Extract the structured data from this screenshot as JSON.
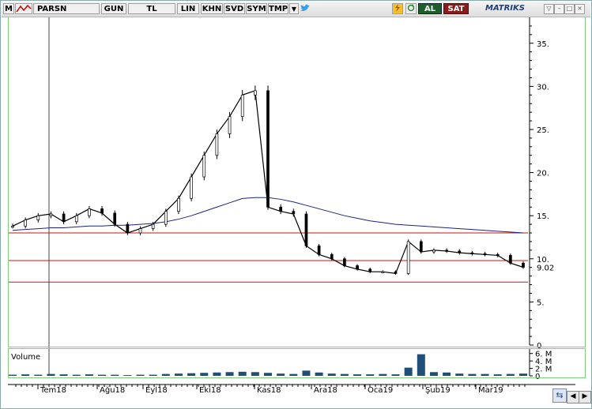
{
  "toolbar": {
    "menu_m": "M",
    "symbol": "PARSN",
    "period": "GUN",
    "currency": "TL",
    "scale": "LIN",
    "btn_khn": "KHN",
    "btn_svd": "SVD",
    "btn_sym": "SYM",
    "btn_tmp": "TMP",
    "buy": "AL",
    "sell": "SAT",
    "brand": "MATRIKS"
  },
  "y_axis": {
    "ticks": [
      "35.",
      "30.",
      "25.",
      "20.",
      "15.",
      "10.",
      "5.",
      "0"
    ],
    "last_price": "9.02"
  },
  "volume": {
    "title": "Volume",
    "ticks": [
      "6. M",
      "4. M",
      "2. M",
      "0"
    ]
  },
  "x_axis": {
    "labels": [
      "Tem18",
      "Ağu18",
      "Eyl18",
      "Eki18",
      "Kas18",
      "Ara18",
      "Oca19",
      "Şub19",
      "Mar19"
    ]
  },
  "colors": {
    "candle": "#000000",
    "moving_average": "#1a237e",
    "hline": "#d01010",
    "volume": "#1f4e79",
    "panel_border": "#7fcf7f"
  },
  "chart_data": {
    "type": "line",
    "title": "",
    "xlabel": "",
    "ylabel": "",
    "ylim": [
      0,
      38
    ],
    "x": [
      "2018-06-27",
      "2018-07-03",
      "2018-07-10",
      "2018-07-17",
      "2018-07-24",
      "2018-07-31",
      "2018-08-07",
      "2018-08-14",
      "2018-08-21",
      "2018-08-28",
      "2018-09-04",
      "2018-09-11",
      "2018-09-18",
      "2018-09-25",
      "2018-10-02",
      "2018-10-09",
      "2018-10-16",
      "2018-10-23",
      "2018-10-30",
      "2018-11-02",
      "2018-11-06",
      "2018-11-13",
      "2018-11-20",
      "2018-11-27",
      "2018-12-04",
      "2018-12-11",
      "2018-12-18",
      "2018-12-25",
      "2019-01-02",
      "2019-01-09",
      "2019-01-16",
      "2019-01-23",
      "2019-01-30",
      "2019-02-06",
      "2019-02-13",
      "2019-02-20",
      "2019-02-27",
      "2019-03-06",
      "2019-03-13",
      "2019-03-20",
      "2019-03-27"
    ],
    "series": [
      {
        "values": [
          13.8,
          14.5,
          15.0,
          15.2,
          14.3,
          15.0,
          15.8,
          15.3,
          14.0,
          13.0,
          13.5,
          14.0,
          15.5,
          17.0,
          19.5,
          22.0,
          24.5,
          26.5,
          29.0,
          29.5,
          16.0,
          15.5,
          15.2,
          11.5,
          10.5,
          10.0,
          9.2,
          8.8,
          8.5,
          8.5,
          8.3,
          12.0,
          10.8,
          11.0,
          10.9,
          10.7,
          10.6,
          10.5,
          10.4,
          9.5,
          9.02
        ]
      },
      {
        "values": [
          13.3,
          13.4,
          13.5,
          13.6,
          13.6,
          13.7,
          13.8,
          13.8,
          13.9,
          13.9,
          14.0,
          14.1,
          14.3,
          14.6,
          15.0,
          15.5,
          16.0,
          16.5,
          17.0,
          17.1,
          17.1,
          16.9,
          16.6,
          16.2,
          15.8,
          15.4,
          15.0,
          14.7,
          14.4,
          14.2,
          14.0,
          13.9,
          13.8,
          13.7,
          13.6,
          13.5,
          13.4,
          13.3,
          13.2,
          13.1,
          13.0
        ]
      }
    ],
    "hlines": [
      13.0,
      9.8,
      7.3
    ],
    "volume_millions": [
      0.3,
      0.4,
      0.3,
      0.5,
      0.4,
      0.3,
      0.4,
      0.3,
      0.3,
      0.2,
      0.3,
      0.3,
      0.5,
      0.6,
      0.7,
      0.8,
      0.9,
      1.0,
      1.1,
      1.0,
      0.8,
      0.6,
      0.5,
      1.4,
      0.9,
      0.6,
      0.5,
      0.4,
      0.4,
      0.5,
      0.4,
      2.2,
      5.8,
      1.0,
      0.9,
      0.6,
      0.5,
      0.5,
      0.4,
      0.5,
      0.6
    ],
    "volume_ylim": [
      0,
      7
    ]
  }
}
